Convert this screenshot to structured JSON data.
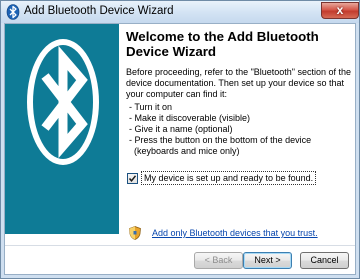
{
  "window": {
    "title": "Add Bluetooth Device Wizard",
    "close_glyph": "x"
  },
  "main": {
    "heading": "Welcome to the Add Bluetooth Device Wizard",
    "intro": "Before proceeding, refer to the \"Bluetooth\" section of the device documentation. Then set up your device so that your computer can find it:",
    "steps": [
      "- Turn it on",
      "- Make it discoverable (visible)",
      "- Give it a name (optional)",
      "- Press the button on the bottom of the device",
      "  (keyboards and mice only)"
    ],
    "checkbox": {
      "label": "My device is set up and ready to be found.",
      "checked": true
    },
    "trust_link": "Add only Bluetooth devices that you trust."
  },
  "buttons": {
    "back": "< Back",
    "next": "Next >",
    "cancel": "Cancel"
  },
  "icons": {
    "title": "bluetooth-icon",
    "banner": "bluetooth-logo",
    "shield": "shield-icon",
    "checkmark": "check-icon"
  },
  "colors": {
    "banner": "#0e7b96",
    "link": "#0645ad",
    "close_button": "#c33c2e"
  }
}
